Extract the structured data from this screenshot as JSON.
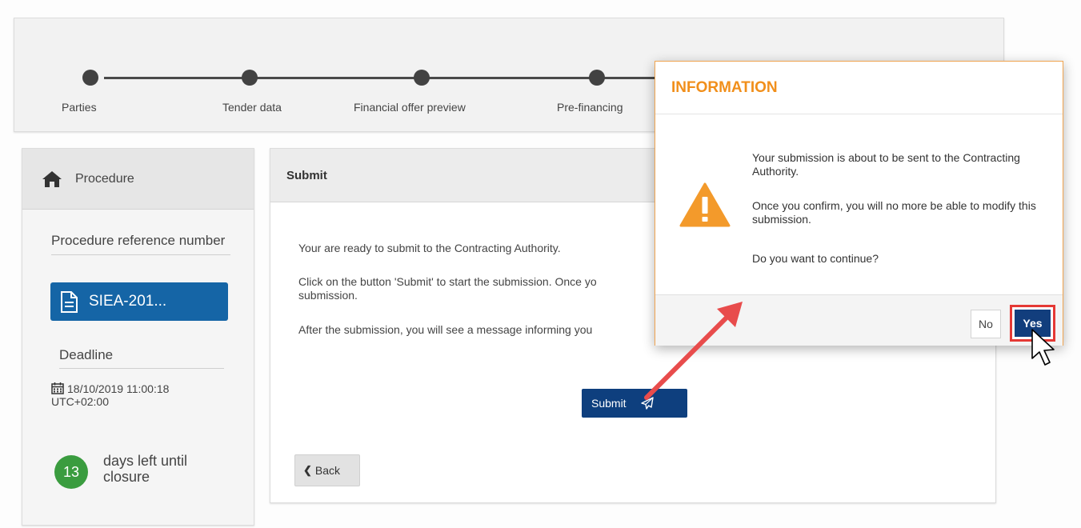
{
  "stepper": {
    "steps": [
      {
        "label": "Parties"
      },
      {
        "label": "Tender data"
      },
      {
        "label": "Financial offer preview"
      },
      {
        "label": "Pre-financing"
      }
    ]
  },
  "procedure": {
    "header": "Procedure",
    "reference_label": "Procedure reference number",
    "reference_value": "SIEA-201...",
    "deadline_label": "Deadline",
    "deadline_date": "18/10/2019 11:00:18",
    "deadline_tz": "UTC+02:00",
    "days_left": "13",
    "days_left_text": "days left until closure"
  },
  "submit": {
    "header": "Submit",
    "line1": "Your are ready to submit to the Contracting Authority.",
    "line2a": "Click on the button 'Submit' to start the submission. Once yo",
    "line2b": "submission.",
    "line3": "After the submission, you will see a message informing you",
    "submit_label": "Submit",
    "back_label": "Back"
  },
  "modal": {
    "title": "INFORMATION",
    "msg1": "Your submission is about to be sent to the Contracting Authority.",
    "msg2": "Once you confirm, you will no more be able to modify this submission.",
    "msg3": "Do you want to continue?",
    "no_label": "No",
    "yes_label": "Yes"
  },
  "colors": {
    "accent_orange": "#f18f1b",
    "primary_blue": "#123e7d",
    "success_green": "#2e8b3a",
    "highlight_red": "#e53935"
  }
}
